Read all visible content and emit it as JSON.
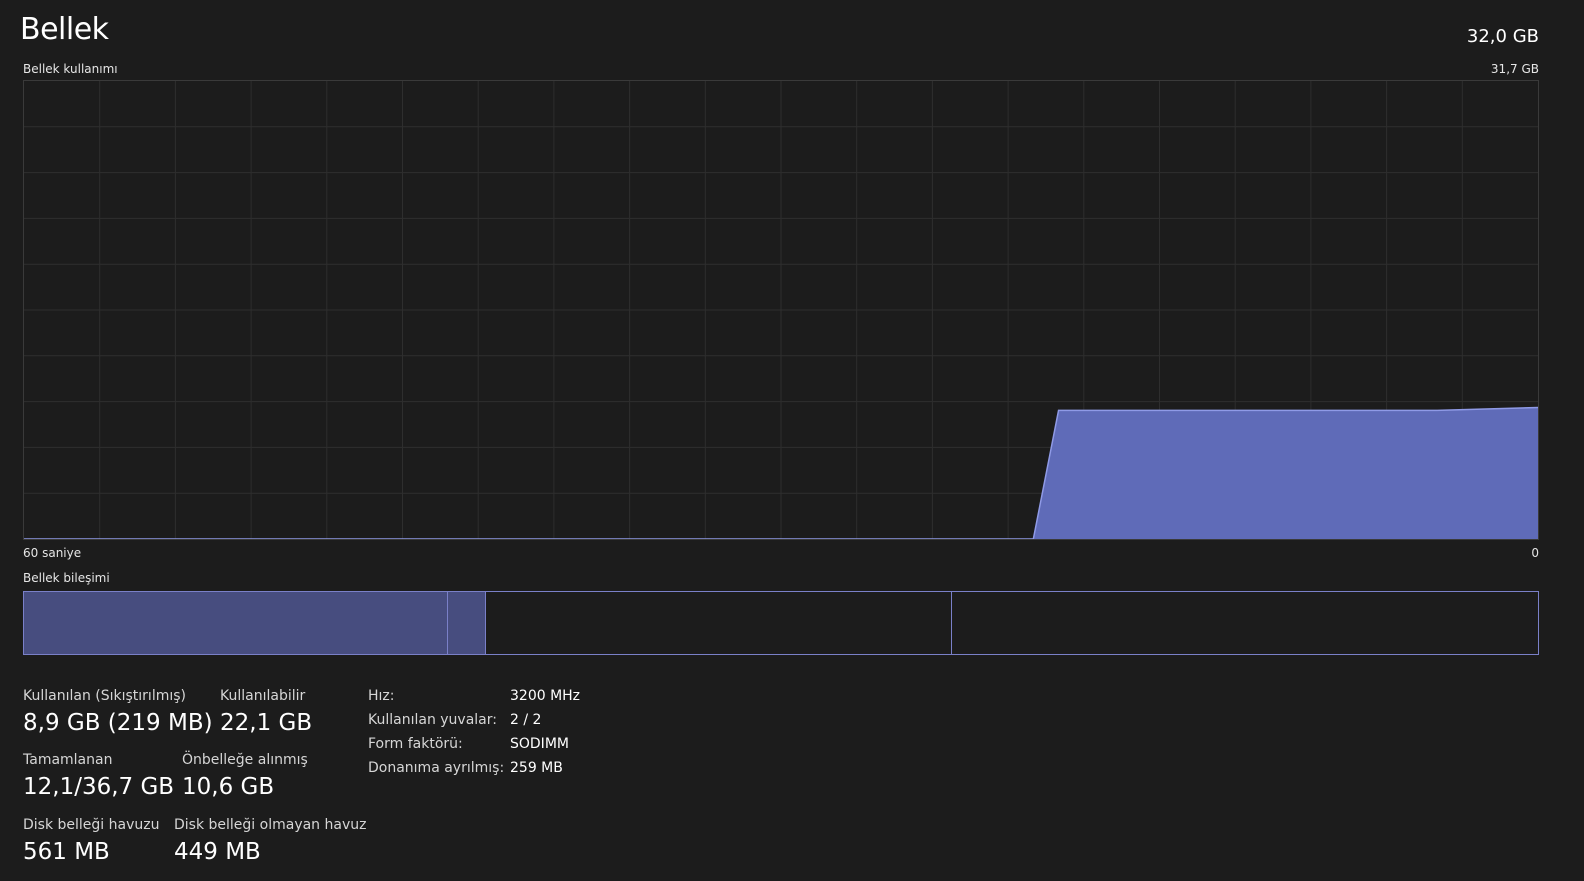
{
  "header": {
    "title": "Bellek",
    "total": "32,0 GB"
  },
  "usage_graph": {
    "label": "Bellek kullanımı",
    "max_label": "31,7 GB",
    "time_left_label": "60 saniye",
    "time_right_label": "0",
    "fill_color": "#5f6bb8",
    "line_color": "#8f9ae6"
  },
  "chart_data": {
    "type": "area",
    "x_label": "60 saniye",
    "x": [
      60,
      56,
      52,
      48,
      44,
      40,
      36,
      32,
      28,
      24,
      20,
      19,
      18,
      16,
      12,
      8,
      4,
      0
    ],
    "series": [
      {
        "values": [
          0,
          0,
          0,
          0,
          0,
          0,
          0,
          0,
          0,
          0,
          0,
          8.9,
          8.9,
          8.9,
          8.9,
          8.9,
          8.9,
          9.1
        ]
      }
    ],
    "ylim": [
      0,
      31.7
    ],
    "xlim": [
      60,
      0
    ],
    "grid": true
  },
  "composition": {
    "label": "Bellek bileşimi",
    "segments": [
      {
        "name": "in-use",
        "fraction": 0.28,
        "color": "#474d7f"
      },
      {
        "name": "modified",
        "fraction": 0.025,
        "color": "#474d7f"
      },
      {
        "name": "standby",
        "fraction": 0.308,
        "color": "#1c1c1c"
      },
      {
        "name": "free",
        "fraction": 0.387,
        "color": "#1c1c1c"
      }
    ]
  },
  "stats": {
    "in_use_label": "Kullanılan (Sıkıştırılmış)",
    "in_use_value": "8,9 GB (219 MB)",
    "available_label": "Kullanılabilir",
    "available_value": "22,1 GB",
    "committed_label": "Tamamlanan",
    "committed_value": "12,1/36,7 GB",
    "cached_label": "Önbelleğe alınmış",
    "cached_value": "10,6 GB",
    "paged_label": "Disk belleği havuzu",
    "paged_value": "561 MB",
    "nonpaged_label": "Disk belleği olmayan havuz",
    "nonpaged_value": "449 MB"
  },
  "details": [
    {
      "key": "Hız:",
      "value": "3200 MHz"
    },
    {
      "key": "Kullanılan yuvalar:",
      "value": "2 / 2"
    },
    {
      "key": "Form faktörü:",
      "value": "SODIMM"
    },
    {
      "key": "Donanıma ayrılmış:",
      "value": "259 MB"
    }
  ]
}
